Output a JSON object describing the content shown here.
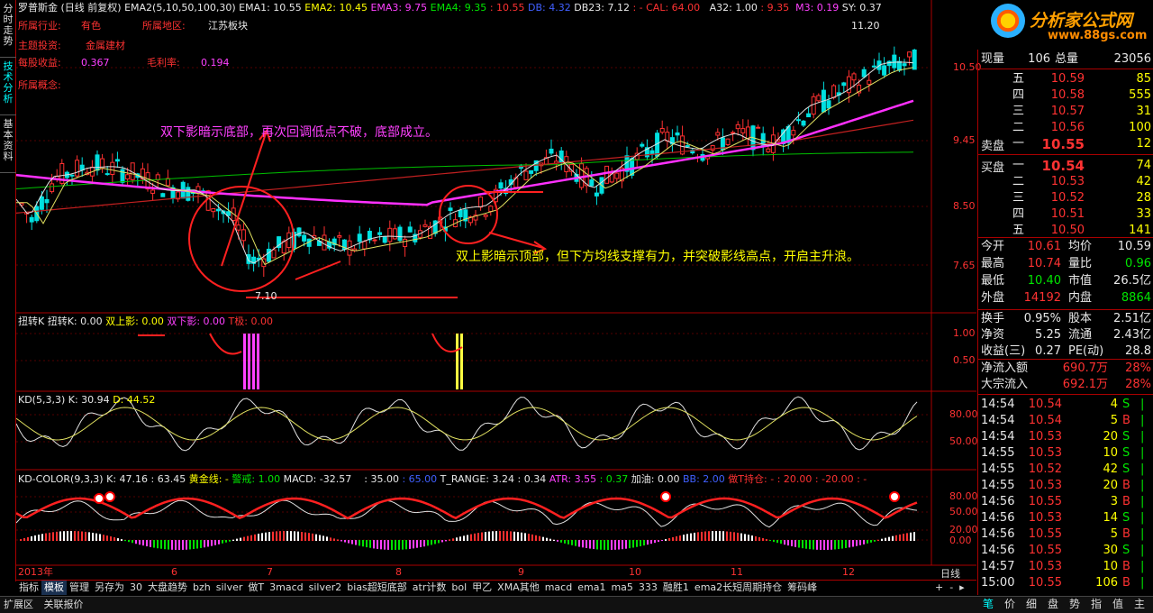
{
  "left_tabs": [
    "分时走势",
    "技术分析",
    "基本资料"
  ],
  "header": {
    "name": "罗普斯金",
    "period": "(日线 前复权)",
    "ema_params": "EMA2(5,10,50,100,30)",
    "ema1": "EMA1: 10.55",
    "ema2": "EMA2: 10.45",
    "ema3": "EMA3: 9.75",
    "ema4": "EMA4: 9.35",
    "v10": ": 10.55",
    "db": "DB: 4.32",
    "db23": "DB23: 7.12",
    "cal": ": - CAL: 64.00",
    "a32": "A32: 1.00",
    "v935": ": 9.35",
    "m3": "M3: 0.19",
    "sy": "SY: 0.37"
  },
  "info": {
    "industry_label": "所属行业:",
    "industry": "有色",
    "region_label": "所属地区:",
    "region": "江苏板块",
    "theme_label": "主题投资:",
    "theme": "金属建材",
    "eps_label": "每股收益:",
    "eps": "0.367",
    "margin_label": "毛利率:",
    "margin": "0.194",
    "concept_label": "所属概念:"
  },
  "annotations": {
    "top": "双下影暗示底部，再次回调低点不破，底部成立。",
    "bottom": "双上影暗示顶部，但下方均线支撑有力，并突破影线高点，开启主升浪。",
    "high": "11.20",
    "low": "7.10"
  },
  "price_axis": [
    "10.50",
    "9.45",
    "8.50",
    "7.65"
  ],
  "watermark": {
    "title": "分析家公式网",
    "url": "www.88gs.com"
  },
  "sub1": {
    "t1": "扭转K",
    "t2": "扭转K: 0.00",
    "t3": "双上影: 0.00",
    "t4": "双下影: 0.00",
    "t5": "T极: 0.00",
    "axis": [
      "1.00",
      "0.50"
    ]
  },
  "sub2": {
    "t1": "KD(5,3,3)",
    "t2": "K: 30.94",
    "t3": "D: 44.52",
    "axis": [
      "80.00",
      "50.00"
    ]
  },
  "sub3": {
    "t1": "KD-COLOR(9,3,3)",
    "t2": "K: 47.16",
    "t3": ": 63.45",
    "t4": "黄金线: -",
    "t5": "警戒: 1.00",
    "t6": "MACD: -32.57",
    "t7": ": 35.00",
    "t8": ": 65.00",
    "t9": "T_RANGE: 3.24",
    "t10": ": 0.34",
    "t11": "ATR: 3.55",
    "t12": ": 0.37",
    "t13": "加油: 0.00",
    "t14": "BB: 2.00",
    "t15": "做T持仓: -",
    "t16": ": 20.00",
    "t17": ": -20.00",
    "t18": ": -",
    "axis": [
      "80.00",
      "50.00",
      "20.00",
      "0.00"
    ]
  },
  "time_axis": [
    "2013年",
    "6",
    "7",
    "8",
    "9",
    "10",
    "11",
    "12"
  ],
  "quote": {
    "now_label": "现量",
    "now": "106",
    "total_label": "总量",
    "total": "23056",
    "asks": [
      {
        "l": "五",
        "p": "10.59",
        "v": "85"
      },
      {
        "l": "四",
        "p": "10.58",
        "v": "555"
      },
      {
        "l": "三",
        "p": "10.57",
        "v": "31"
      },
      {
        "l": "二",
        "p": "10.56",
        "v": "100"
      },
      {
        "l": "一",
        "p": "10.55",
        "v": "12"
      }
    ],
    "sell_label": "卖盘",
    "buy_label": "买盘",
    "bids": [
      {
        "l": "一",
        "p": "10.54",
        "v": "74"
      },
      {
        "l": "二",
        "p": "10.53",
        "v": "42"
      },
      {
        "l": "三",
        "p": "10.52",
        "v": "28"
      },
      {
        "l": "四",
        "p": "10.51",
        "v": "33"
      },
      {
        "l": "五",
        "p": "10.50",
        "v": "141"
      }
    ],
    "stats": [
      {
        "a": "今开",
        "av": "10.61",
        "b": "均价",
        "bv": "10.59"
      },
      {
        "a": "最高",
        "av": "10.74",
        "b": "量比",
        "bv": "0.96"
      },
      {
        "a": "最低",
        "av": "10.40",
        "b": "市值",
        "bv": "26.5亿"
      },
      {
        "a": "外盘",
        "av": "14192",
        "b": "内盘",
        "bv": "8864"
      }
    ],
    "stats2": [
      {
        "a": "换手",
        "av": "0.95%",
        "b": "股本",
        "bv": "2.51亿"
      },
      {
        "a": "净资",
        "av": "5.25",
        "b": "流通",
        "bv": "2.43亿"
      },
      {
        "a": "收益(三)",
        "av": "0.27",
        "b": "PE(动)",
        "bv": "28.8"
      }
    ],
    "flow": [
      {
        "a": "净流入额",
        "v": "690.7万",
        "p": "28%"
      },
      {
        "a": "大宗流入",
        "v": "692.1万",
        "p": "28%"
      }
    ],
    "ticks": [
      {
        "t": "14:54",
        "p": "10.54",
        "v": "4",
        "s": "S"
      },
      {
        "t": "14:54",
        "p": "10.54",
        "v": "5",
        "s": "B"
      },
      {
        "t": "14:54",
        "p": "10.53",
        "v": "20",
        "s": "S"
      },
      {
        "t": "14:55",
        "p": "10.53",
        "v": "10",
        "s": "S"
      },
      {
        "t": "14:55",
        "p": "10.52",
        "v": "42",
        "s": "S"
      },
      {
        "t": "14:55",
        "p": "10.53",
        "v": "20",
        "s": "B"
      },
      {
        "t": "14:56",
        "p": "10.55",
        "v": "3",
        "s": "B"
      },
      {
        "t": "14:56",
        "p": "10.53",
        "v": "14",
        "s": "S"
      },
      {
        "t": "14:56",
        "p": "10.55",
        "v": "5",
        "s": "B"
      },
      {
        "t": "14:56",
        "p": "10.55",
        "v": "30",
        "s": "S"
      },
      {
        "t": "14:57",
        "p": "10.53",
        "v": "10",
        "s": "B"
      },
      {
        "t": "15:00",
        "p": "10.55",
        "v": "106",
        "s": "B"
      }
    ]
  },
  "bottom_tabs": [
    "指标",
    "模板",
    "管理",
    "另存为",
    "30",
    "大盘趋势",
    "bzh",
    "silver",
    "做T",
    "3macd",
    "silver2",
    "bias超短底部",
    "atr计数",
    "bol",
    "甲乙",
    "XMA其他",
    "macd",
    "ema1",
    "ma5",
    "333",
    "融胜1",
    "ema2长短周期持仓",
    "筹码峰"
  ],
  "period_label": "日线",
  "status": {
    "left": "扩展区",
    "right": "关联报价"
  },
  "right_tabs": [
    "笔",
    "价",
    "细",
    "盘",
    "势",
    "指",
    "值",
    "主"
  ]
}
